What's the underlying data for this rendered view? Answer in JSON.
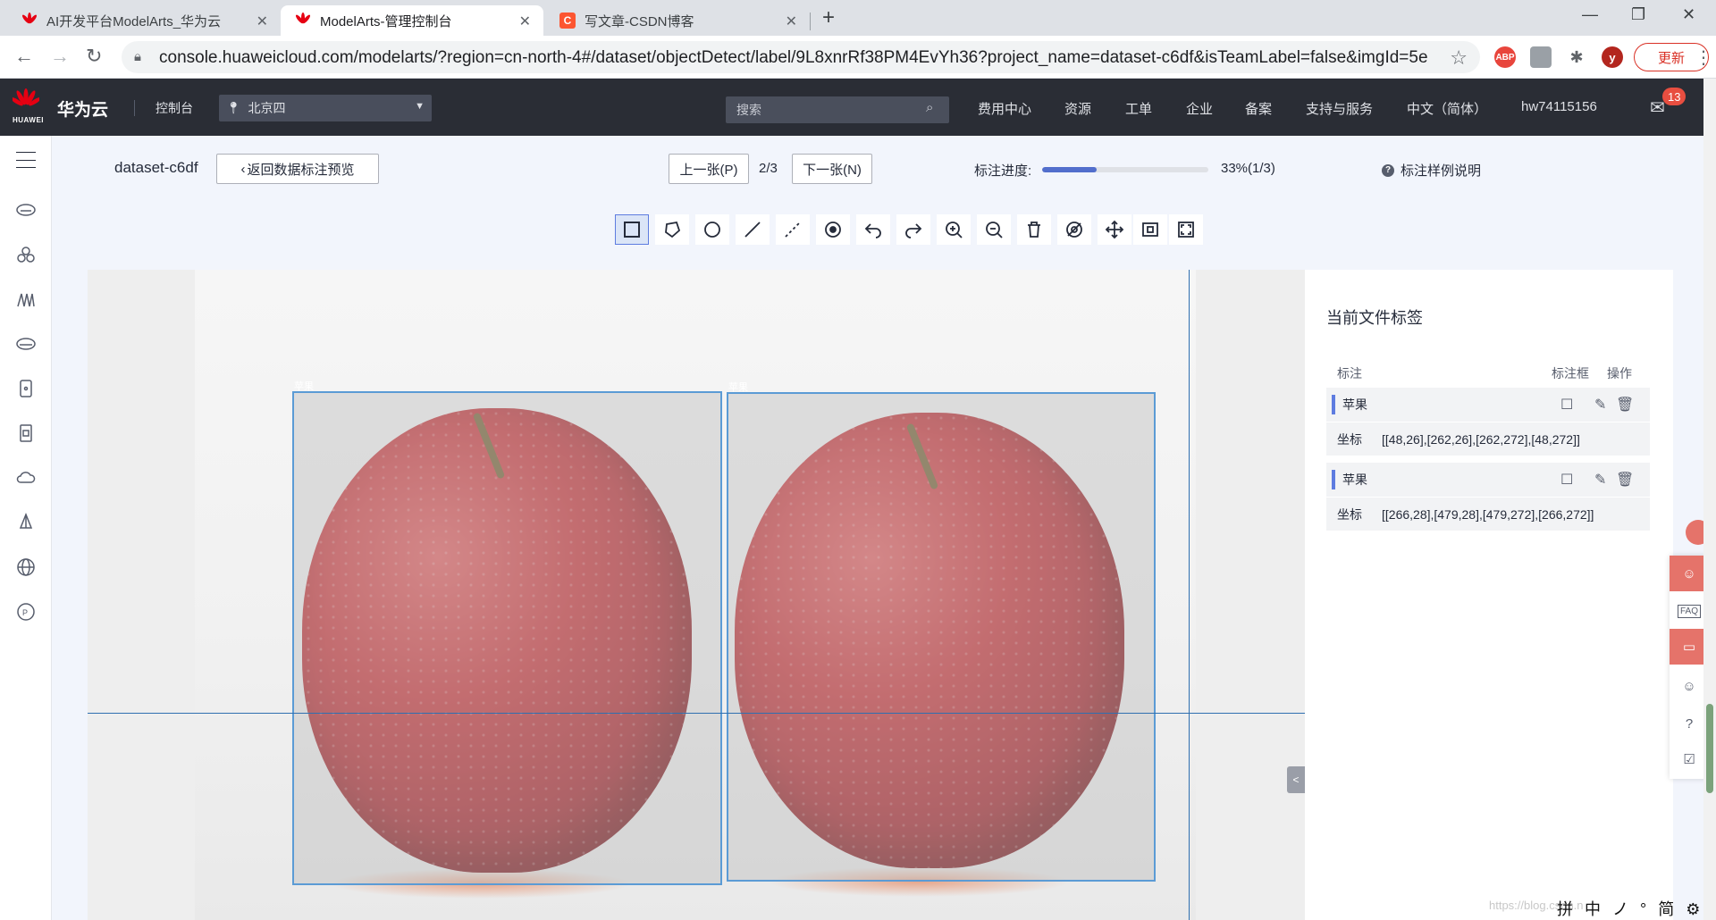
{
  "browser": {
    "tabs": [
      {
        "title": "AI开发平台ModelArts_华为云",
        "favicon": "huawei-favicon",
        "active": false
      },
      {
        "title": "ModelArts-管理控制台",
        "favicon": "huawei-favicon",
        "active": true
      },
      {
        "title": "写文章-CSDN博客",
        "favicon": "csdn-favicon",
        "active": false
      }
    ],
    "url": "console.huaweicloud.com/modelarts/?region=cn-north-4#/dataset/objectDetect/label/9L8xnrRf38PM4EvYh36?project_name=dataset-c6df&isTeamLabel=false&imgId=5e",
    "update_button": "更新",
    "profile_initial": "y",
    "abp_badge": "ABP"
  },
  "header": {
    "logo_text": "HUAWEI",
    "brand": "华为云",
    "console": "控制台",
    "region": "北京四",
    "search_placeholder": "搜索",
    "nav": [
      "费用中心",
      "资源",
      "工单",
      "企业",
      "备案",
      "支持与服务",
      "中文（简体）",
      "hw74115156"
    ],
    "mail_count": "13"
  },
  "toolbar": {
    "dataset_name": "dataset-c6df",
    "back_button": "返回数据标注预览",
    "prev_button": "上一张(P)",
    "page_counter": "2/3",
    "next_button": "下一张(N)",
    "progress_label": "标注进度:",
    "progress_fraction": 0.33,
    "progress_text": "33%(1/3)",
    "help_link": "标注样例说明"
  },
  "tools": [
    "rectangle-tool",
    "polygon-tool",
    "circle-tool",
    "line-tool",
    "dashed-line-tool",
    "point-tool",
    "undo-tool",
    "redo-tool",
    "zoom-in-tool",
    "zoom-out-tool",
    "delete-tool",
    "hide-tool",
    "move-tool",
    "fit-tool",
    "fullscreen-tool"
  ],
  "canvas": {
    "box_labels": [
      "苹果",
      "苹果"
    ],
    "collapse_label": "<"
  },
  "panel": {
    "title": "当前文件标签",
    "col_label": "标注",
    "col_box": "标注框",
    "col_ops": "操作",
    "coord_key": "坐标",
    "annotations": [
      {
        "label": "苹果",
        "coords": "[[48,26],[262,26],[262,272],[48,272]]"
      },
      {
        "label": "苹果",
        "coords": "[[266,28],[479,28],[479,272],[266,272]]"
      }
    ]
  },
  "float_tools": [
    "chat-icon",
    "faq-icon",
    "message-icon",
    "smile-icon",
    "question-icon",
    "edit-icon"
  ],
  "faq_label": "FAQ",
  "ime": "拼 中 ノ ° 简 ⚙ ⋮",
  "watermark": "https://blog.csdn.n"
}
